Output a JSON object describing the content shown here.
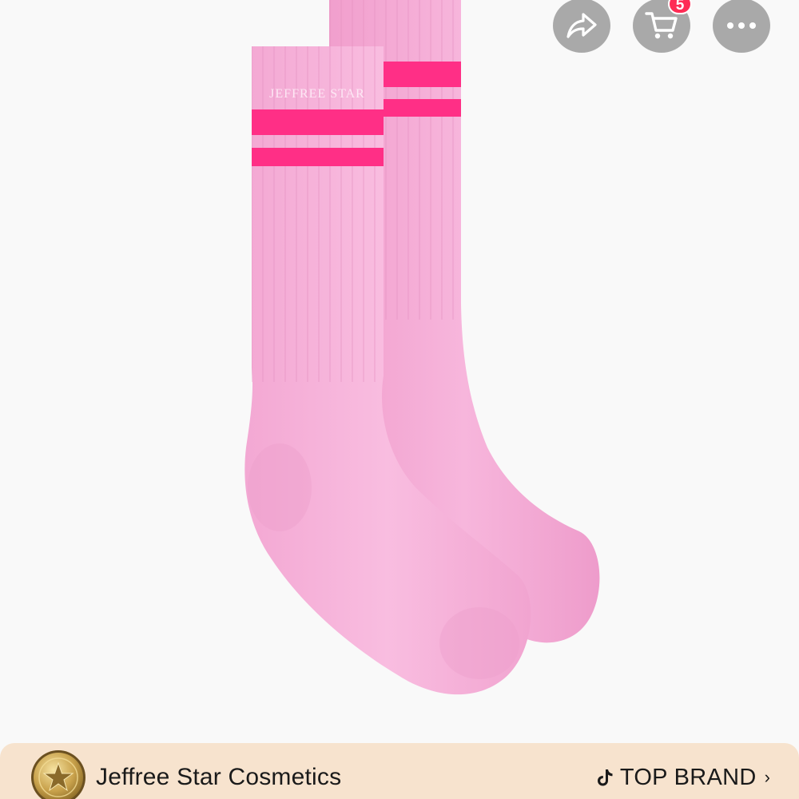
{
  "product": {
    "image_alt": "Pink crew socks with two hot pink stripes",
    "sock_logo_text": "JEFFREE STAR"
  },
  "header": {
    "cart_count": "5"
  },
  "brand_bar": {
    "store_name": "Jeffree Star Cosmetics",
    "badge_label": "TOP BRAND",
    "chevron": "›"
  },
  "colors": {
    "sock_pink": "#f4a9d2",
    "stripe_pink": "#ff2f86",
    "badge_red": "#fe2c55",
    "brand_bar_bg": "#f7e3ce"
  },
  "icons": {
    "share": "share-icon",
    "cart": "cart-icon",
    "more": "more-icon",
    "brand": "brand-logo-icon",
    "tiktok": "tiktok-icon",
    "chevron": "chevron-right-icon"
  }
}
